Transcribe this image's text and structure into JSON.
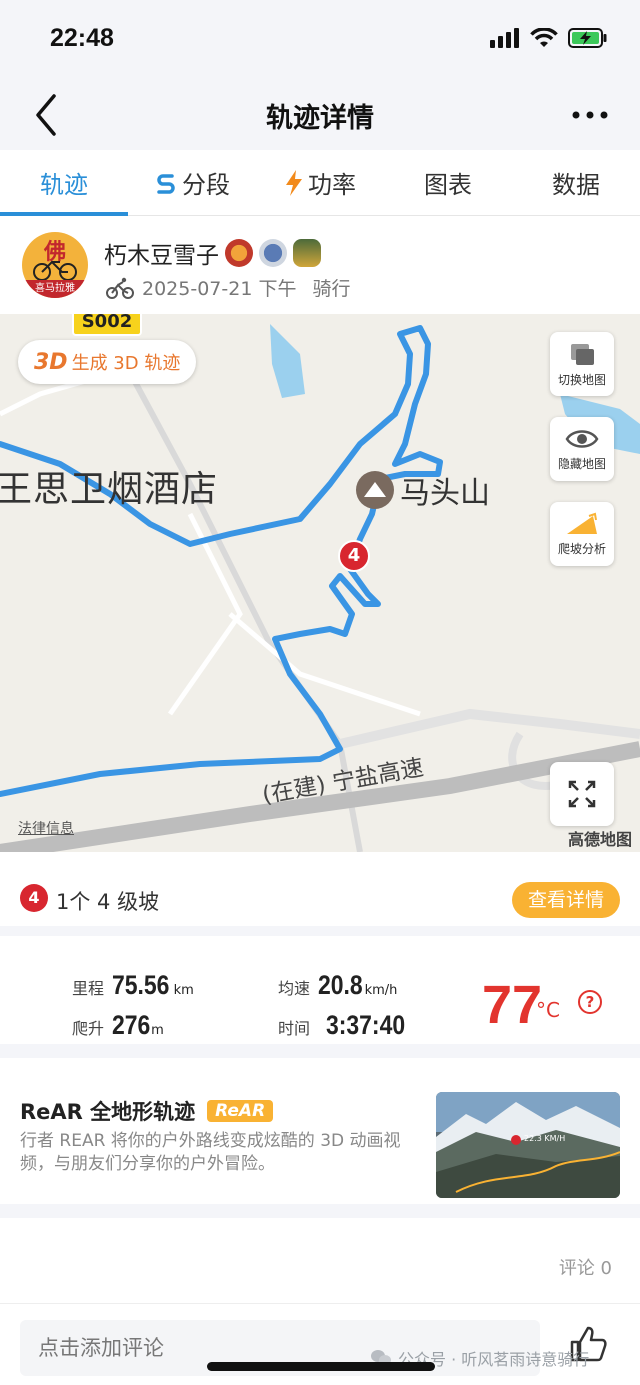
{
  "status_bar": {
    "time": "22:48",
    "icons": [
      "signal-icon",
      "wifi-icon",
      "battery-charging-icon"
    ]
  },
  "nav": {
    "title": "轨迹详情",
    "back_icon": "chevron-left-icon",
    "more_icon": "more-dots-icon"
  },
  "tabs": [
    {
      "label": "轨迹",
      "active": true
    },
    {
      "label": "分段",
      "icon": "segment-icon"
    },
    {
      "label": "功率",
      "icon": "lightning-icon"
    },
    {
      "label": "图表"
    },
    {
      "label": "数据"
    }
  ],
  "user": {
    "name": "朽木豆雪子",
    "avatar_text": "佛",
    "avatar_caption": "喜马拉雅",
    "date": "2025-07-21 下午",
    "activity": "骑行"
  },
  "map": {
    "road_sign": "S002",
    "btn_3d_prefix": "3D",
    "btn_3d_label": "生成 3D 轨迹",
    "place_label": "王思卫烟酒店",
    "poi_label": "马头山",
    "climb_marker": "4",
    "highway_label": "(在建) 宁盐高速",
    "legal_label": "法律信息",
    "provider_label": "高德地图",
    "tools": {
      "switch_map": "切换地图",
      "hide_map": "隐藏地图",
      "climb_analysis": "爬坡分析"
    }
  },
  "climb": {
    "badge": "4",
    "text": "1个 4 级坡",
    "details_button": "查看详情"
  },
  "stats": {
    "distance_label": "里程",
    "distance_value": "75.56",
    "distance_unit": "km",
    "climb_label": "爬升",
    "climb_value": "276",
    "climb_unit": "m",
    "avg_speed_label": "均速",
    "avg_speed_value": "20.8",
    "avg_speed_unit": "km/h",
    "time_label": "时间",
    "time_value": "3:37:40",
    "temperature_value": "77",
    "temperature_unit": "°C",
    "help_symbol": "?"
  },
  "rear": {
    "title": "ReAR 全地形轨迹",
    "tag": "ReAR",
    "description": "行者 REAR 将你的户外路线变成炫酷的 3D 动画视频，与朋友们分享你的户外冒险。",
    "thumb_speed": "22.3 KM/H"
  },
  "comments": {
    "count_label": "评论 0"
  },
  "bottom": {
    "input_placeholder": "点击添加评论",
    "watermark": "公众号 · 听风茗雨诗意骑行"
  },
  "colors": {
    "accent": "#2a8fd8",
    "route": "#3a95e4",
    "temperature": "#e2342e",
    "button_orange": "#f9b233"
  }
}
